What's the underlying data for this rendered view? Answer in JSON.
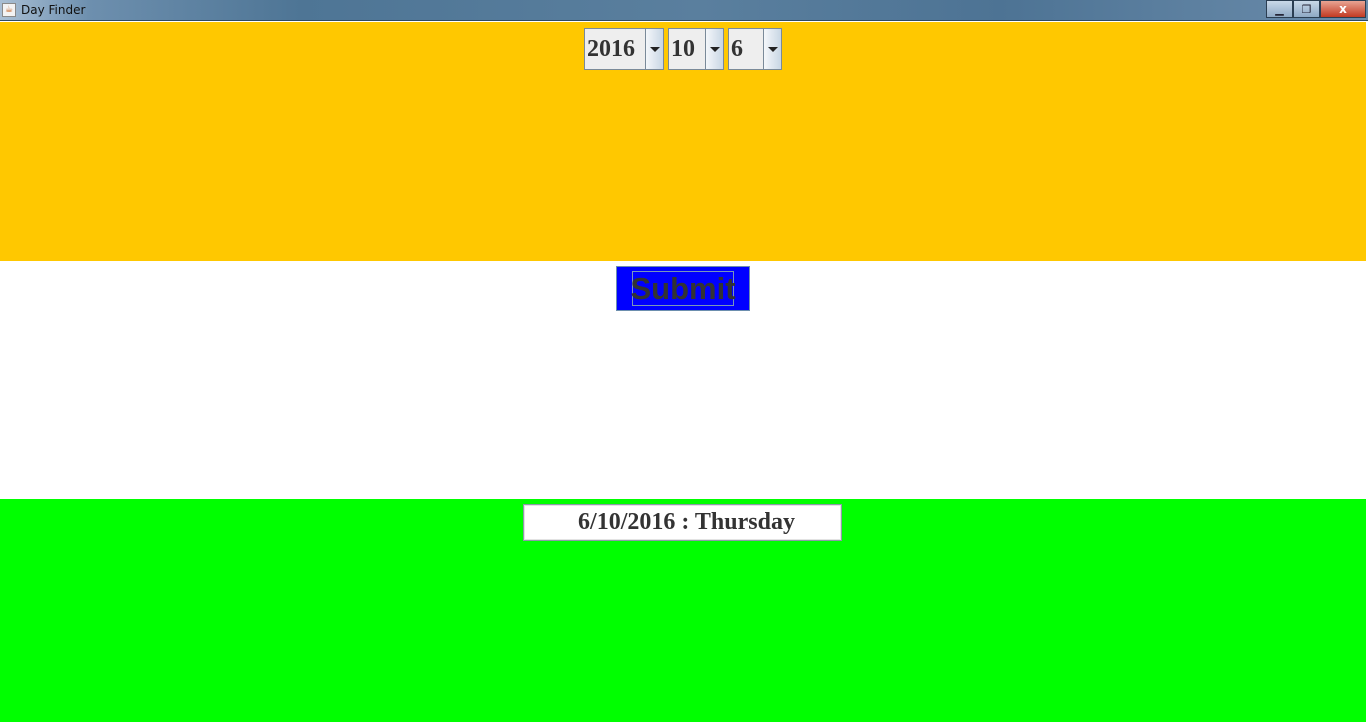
{
  "window": {
    "title": "Day Finder",
    "app_icon": "java-cup-icon",
    "controls": {
      "minimize_icon": "minimize-icon",
      "maximize_icon": "restore-icon",
      "close_icon": "close-icon",
      "close_glyph": "x"
    }
  },
  "date_selectors": {
    "year": {
      "value": "2016"
    },
    "month": {
      "value": "10"
    },
    "day": {
      "value": "6"
    }
  },
  "actions": {
    "submit_label": "Submit"
  },
  "result": {
    "text": "6/10/2016 : Thursday"
  },
  "colors": {
    "top_panel": "#ffc800",
    "middle_panel": "#ffffff",
    "bottom_panel": "#00ff00",
    "submit_button": "#0000ff",
    "text": "#333333"
  }
}
